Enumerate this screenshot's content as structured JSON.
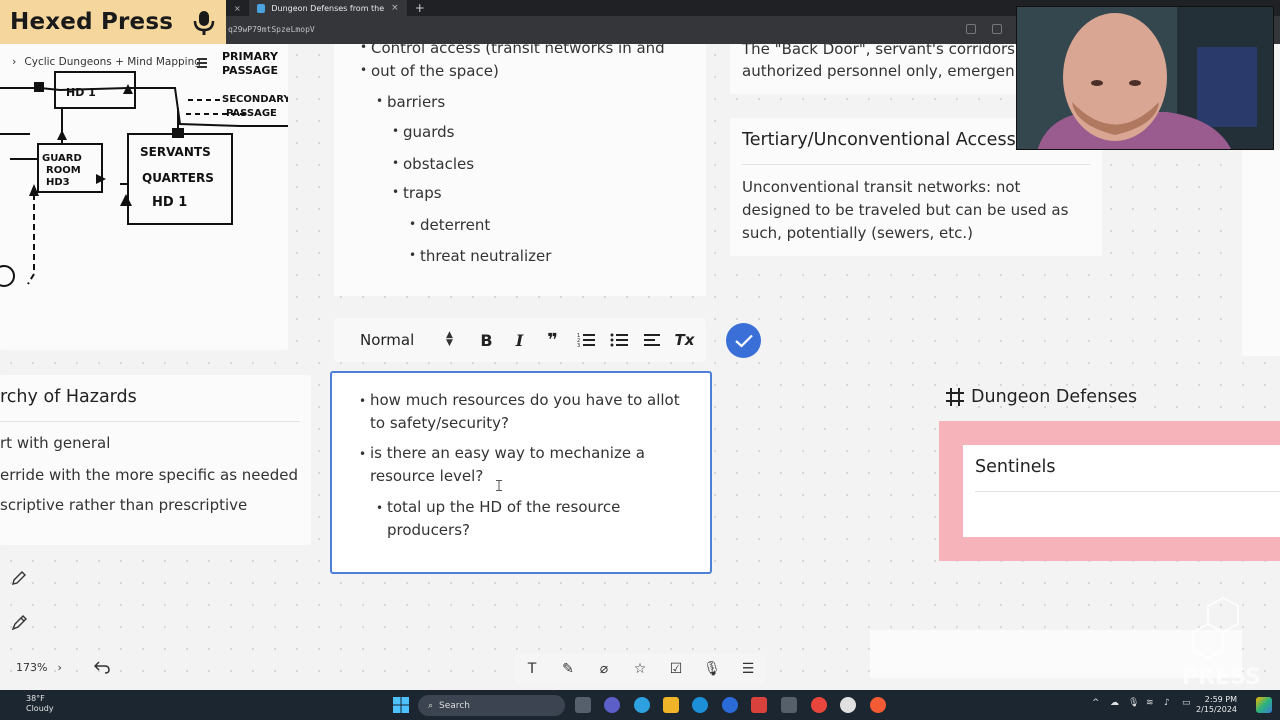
{
  "browser": {
    "tab_title": "Dungeon Defenses from the Per",
    "url": "q29wP79mtSpzeLmopV"
  },
  "logo": {
    "text": "Hexed Press"
  },
  "nav": {
    "breadcrumb": "Cyclic Dungeons + Mind Mapping"
  },
  "sketch": {
    "labels": [
      "PRIMARY PASSAGE",
      "SECONDARY PASSAGE",
      "HD 1",
      "GUARD ROOM HD3",
      "SERVANTS QUARTERS HD 1"
    ]
  },
  "control_card": {
    "top_line": "Control access (transit networks in and",
    "top_line2": "out of the space)",
    "items": [
      "barriers",
      "guards",
      "obstacles",
      "traps",
      "deterrent",
      "threat neutralizer"
    ]
  },
  "backdoor_card": {
    "line1": "The \"Back Door\", servant's corridors",
    "line2": "authorized personnel only, emergen"
  },
  "tertiary_card": {
    "heading": "Tertiary/Unconventional Access",
    "body": "Unconventional transit networks: not designed to be traveled but can be used as such, potentially (sewers, etc.)"
  },
  "hierarchy_card": {
    "heading": "rchy of Hazards",
    "items": [
      "rt with general",
      "erride with the more specific as needed",
      "scriptive rather than prescriptive"
    ]
  },
  "toolbar": {
    "style_value": "Normal",
    "bold": "B",
    "italic": "I",
    "quote": "❞",
    "clear": "Tx"
  },
  "editor": {
    "items": [
      "how much resources do you have to allot to safety/security?",
      "is there an easy way to mechanize a resource level?",
      "total up the HD of the resource producers?"
    ]
  },
  "frame": {
    "title": "Dungeon Defenses",
    "card_title": "Sentinels"
  },
  "zoom": {
    "level": "173%"
  },
  "taskbar": {
    "temp": "38°F",
    "condition": "Cloudy",
    "search_placeholder": "Search",
    "time": "2:59 PM",
    "date": "2/15/2024"
  },
  "colors": {
    "accent": "#3a6fd8",
    "logo_bg": "#f5d79e",
    "frame_pink": "#f6b3b9"
  }
}
